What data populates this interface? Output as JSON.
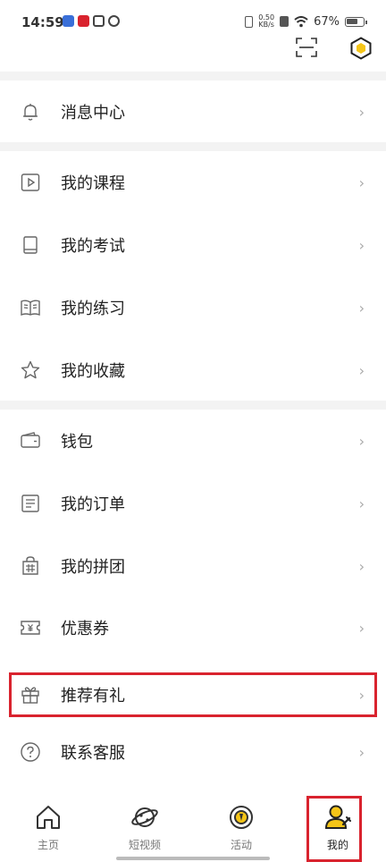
{
  "status_bar": {
    "time": "14:59",
    "netspeed_value": "0.50",
    "netspeed_unit": "KB/s",
    "battery": "67%"
  },
  "header": {
    "scan_icon": "scan-icon",
    "badge_icon": "hexagon-badge-icon"
  },
  "sections": {
    "notifications": [
      {
        "label": "消息中心",
        "icon": "bell-icon"
      }
    ],
    "learning": [
      {
        "label": "我的课程",
        "icon": "play-icon"
      },
      {
        "label": "我的考试",
        "icon": "book-icon"
      },
      {
        "label": "我的练习",
        "icon": "open-book-icon"
      },
      {
        "label": "我的收藏",
        "icon": "star-icon"
      }
    ],
    "account": [
      {
        "label": "钱包",
        "icon": "wallet-icon"
      },
      {
        "label": "我的订单",
        "icon": "order-icon"
      },
      {
        "label": "我的拼团",
        "icon": "group-buy-icon"
      },
      {
        "label": "优惠券",
        "icon": "coupon-icon"
      },
      {
        "label": "推荐有礼",
        "icon": "gift-icon"
      },
      {
        "label": "联系客服",
        "icon": "help-icon"
      }
    ]
  },
  "arrow": "›",
  "tabs": [
    {
      "label": "主页",
      "icon": "home-icon",
      "active": false
    },
    {
      "label": "短视频",
      "icon": "planet-icon",
      "active": false
    },
    {
      "label": "活动",
      "icon": "activity-icon",
      "active": false
    },
    {
      "label": "我的",
      "icon": "profile-icon",
      "active": true
    }
  ],
  "colors": {
    "accent": "#f5c518",
    "highlight": "#d9232e"
  }
}
